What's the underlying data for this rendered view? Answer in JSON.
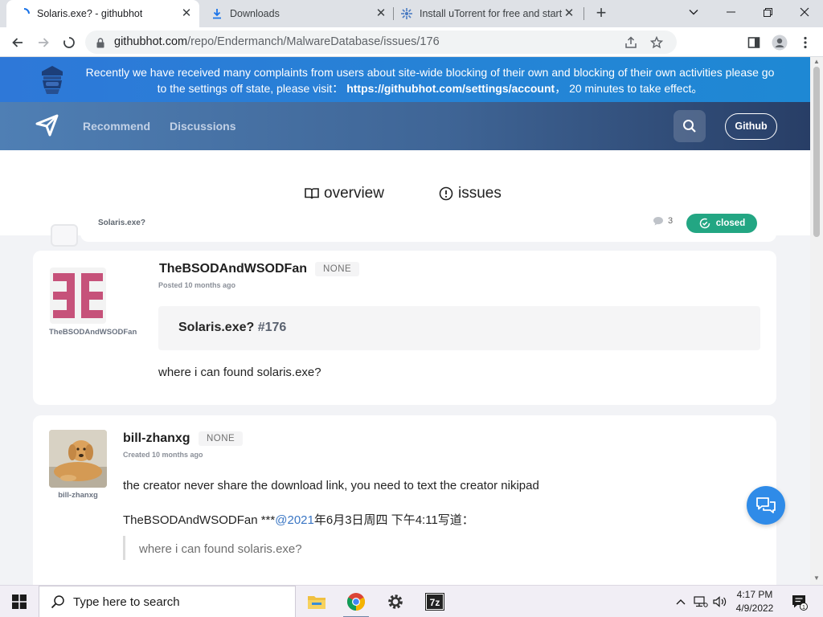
{
  "browser": {
    "tabs": [
      {
        "title": "Solaris.exe? - githubhot",
        "active": true
      },
      {
        "title": "Downloads",
        "active": false
      },
      {
        "title": "Install uTorrent for free and start",
        "active": false
      }
    ],
    "url_host": "githubhot.com",
    "url_path": "/repo/Endermanch/MalwareDatabase/issues/176"
  },
  "banner": {
    "text_before": "Recently we have received many complaints from users about site-wide blocking of their own and blocking of their own activities please go to the settings off state, please visit：",
    "link": "https://githubhot.com/settings/account",
    "text_after": "，  20 minutes to take effect。"
  },
  "nav": {
    "recommend": "Recommend",
    "discussions": "Discussions",
    "github": "Github"
  },
  "page_tabs": {
    "overview": "overview",
    "issues": "issues"
  },
  "issue": {
    "title": "Solaris.exe?",
    "comment_count": "3",
    "status": "closed",
    "status_color": "#23a683"
  },
  "comments": [
    {
      "author": "TheBSODAndWSODFan",
      "avatar_name": "TheBSODAndWSODFan",
      "role": "NONE",
      "posted": "Posted 10 months ago",
      "quote_title": "Solaris.exe?",
      "quote_number": "#176",
      "body": "where i can found solaris.exe?"
    },
    {
      "author": "bill-zhanxg",
      "avatar_name": "bill-zhanxg",
      "role": "NONE",
      "posted": "Created 10 months ago",
      "body": "the creator never share the download link, you need to text the creator nikipad",
      "reply_prefix": "TheBSODAndWSODFan ***",
      "reply_link": "@2021",
      "reply_suffix": "年6月3日周四 下午4:11写道：",
      "quoted": "where i can found solaris.exe?"
    }
  ],
  "taskbar": {
    "search_placeholder": "Type here to search",
    "time": "4:17 PM",
    "date": "4/9/2022",
    "notification_count": "1"
  }
}
